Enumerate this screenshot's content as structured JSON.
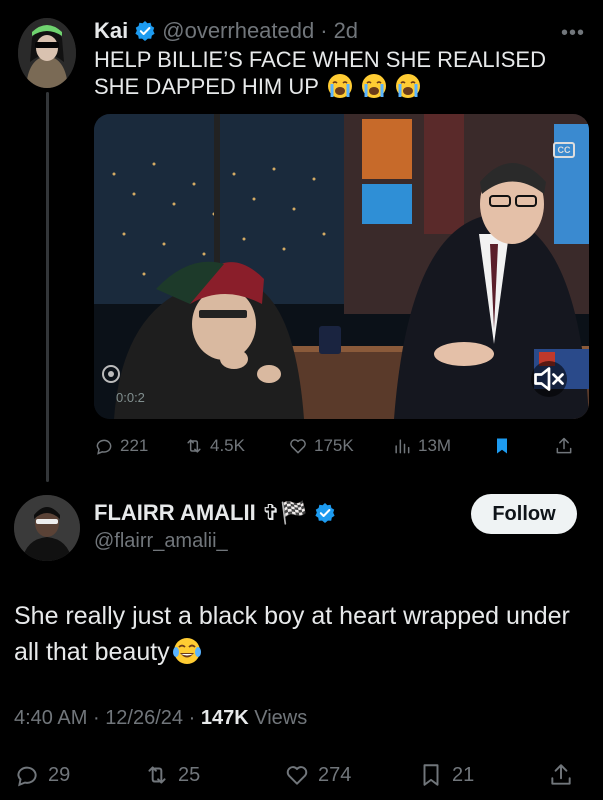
{
  "parent_tweet": {
    "author_name": "Kai",
    "handle": "@overrheatedd",
    "separator": "·",
    "time_ago": "2d",
    "text": "HELP BILLIE’S FACE WHEN SHE REALISED SHE DAPPED HIM UP",
    "emoji": "loudly-crying-face",
    "emoji_count": 3,
    "video": {
      "timestamp": "0:0:2",
      "cc_label": "CC"
    },
    "stats": {
      "replies": "221",
      "reposts": "4.5K",
      "likes": "175K",
      "views": "13M"
    }
  },
  "main_tweet": {
    "author_name": "FLAIRR AMALII",
    "name_symbols": "✞🏁",
    "handle": "@flairr_amalii_",
    "follow_label": "Follow",
    "text": "She really just a black boy at heart wrapped under all that beauty",
    "emoji": "face-with-tears-of-joy",
    "time": "4:40 AM",
    "date": "12/26/24",
    "views_count": "147K",
    "views_label": "Views",
    "stats": {
      "replies": "29",
      "reposts": "25",
      "likes": "274",
      "bookmarks": "21"
    }
  },
  "colors": {
    "background": "#000000",
    "text_primary": "#e7e9ea",
    "text_secondary": "#71767b",
    "verified": "#1d9bf0",
    "bookmark_active": "#1d9bf0"
  }
}
